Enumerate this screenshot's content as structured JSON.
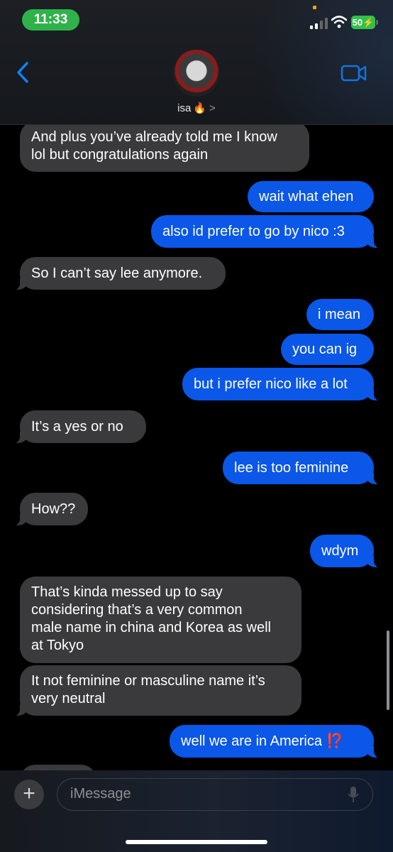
{
  "status_bar": {
    "time": "11:33",
    "battery": "50"
  },
  "header": {
    "contact_name": "isa",
    "contact_emoji": "🔥",
    "chevron": ">"
  },
  "messages": [
    {
      "from": "them",
      "lines": [
        "And plus you’ve already told me I know",
        "lol but congratulations again"
      ]
    },
    {
      "from": "me",
      "lines": [
        "wait what ehen"
      ]
    },
    {
      "from": "me",
      "lines": [
        "also id prefer to go by nico :3"
      ]
    },
    {
      "from": "them",
      "lines": [
        "So I can’t say lee anymore."
      ]
    },
    {
      "from": "me",
      "lines": [
        "i mean"
      ]
    },
    {
      "from": "me",
      "lines": [
        "you can ig"
      ]
    },
    {
      "from": "me",
      "lines": [
        "but i prefer nico like a lot"
      ]
    },
    {
      "from": "them",
      "lines": [
        "It’s a yes or no"
      ]
    },
    {
      "from": "me",
      "lines": [
        "lee is too feminine"
      ]
    },
    {
      "from": "them",
      "lines": [
        "How??"
      ]
    },
    {
      "from": "me",
      "lines": [
        "wdym"
      ]
    },
    {
      "from": "them",
      "lines": [
        "That’s kinda messed up to say",
        "considering that’s a very common",
        "male name in china and Korea as well",
        "at Tokyo"
      ]
    },
    {
      "from": "them",
      "lines": [
        "It not feminine or masculine name it’s",
        "very neutral"
      ]
    },
    {
      "from": "me",
      "lines": [
        "well we are in America ⁉️"
      ]
    }
  ],
  "composer": {
    "plus": "+",
    "placeholder": "iMessage"
  },
  "colors": {
    "outgoing": "#0a57e8",
    "incoming": "#3a3a3c",
    "accent": "#0a84ff"
  }
}
